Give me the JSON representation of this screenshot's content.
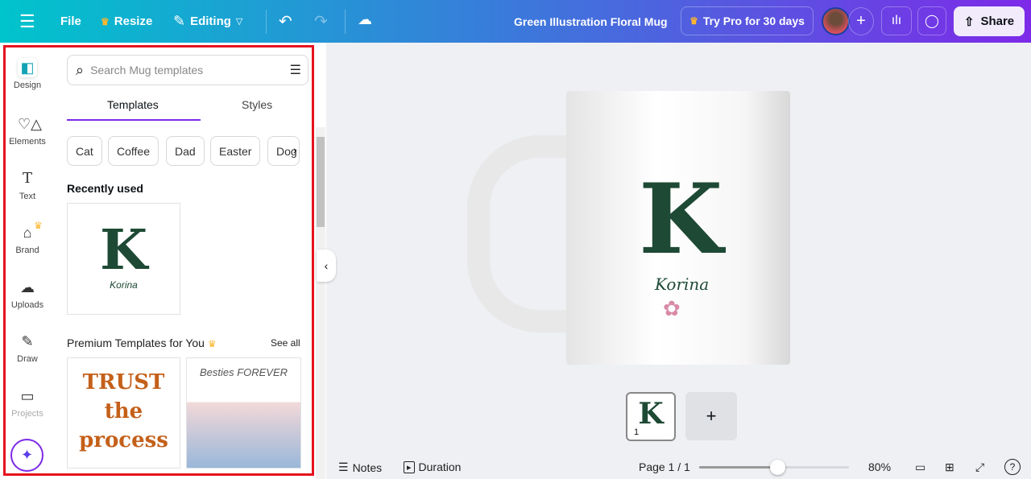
{
  "topbar": {
    "file": "File",
    "resize": "Resize",
    "editing": "Editing",
    "title": "Green Illustration Floral Mug",
    "try_pro": "Try Pro for 30 days",
    "share": "Share"
  },
  "rail": [
    {
      "label": "Design",
      "icon": "design-icon"
    },
    {
      "label": "Elements",
      "icon": "elements-icon"
    },
    {
      "label": "Text",
      "icon": "text-icon"
    },
    {
      "label": "Brand",
      "icon": "brand-icon"
    },
    {
      "label": "Uploads",
      "icon": "uploads-icon"
    },
    {
      "label": "Draw",
      "icon": "draw-icon"
    },
    {
      "label": "Projects",
      "icon": "folder-icon"
    }
  ],
  "panel": {
    "search_placeholder": "Search Mug templates",
    "tabs": [
      "Templates",
      "Styles"
    ],
    "chips": [
      "Cat",
      "Coffee",
      "Dad",
      "Easter",
      "Dog"
    ],
    "recent": "Recently used",
    "premium": "Premium Templates for You",
    "see_all": "See all",
    "recent_thumb": {
      "letter": "K",
      "name": "Korina"
    },
    "premium_thumbs": [
      {
        "text": "TRUST the process"
      },
      {
        "text": "Besties FOREVER"
      }
    ]
  },
  "design": {
    "letter": "K",
    "name": "Korina"
  },
  "pages": {
    "thumb_number": "1",
    "thumb_letter": "K",
    "add": "+"
  },
  "bottom": {
    "notes": "Notes",
    "duration": "Duration",
    "page": "Page 1 / 1",
    "zoom": "80%",
    "zoom_value": 80,
    "slider_fraction": 0.52
  },
  "colors": {
    "accent": "#7d2ae8",
    "highlight": "#e5131f",
    "letter": "#1e4a35"
  }
}
